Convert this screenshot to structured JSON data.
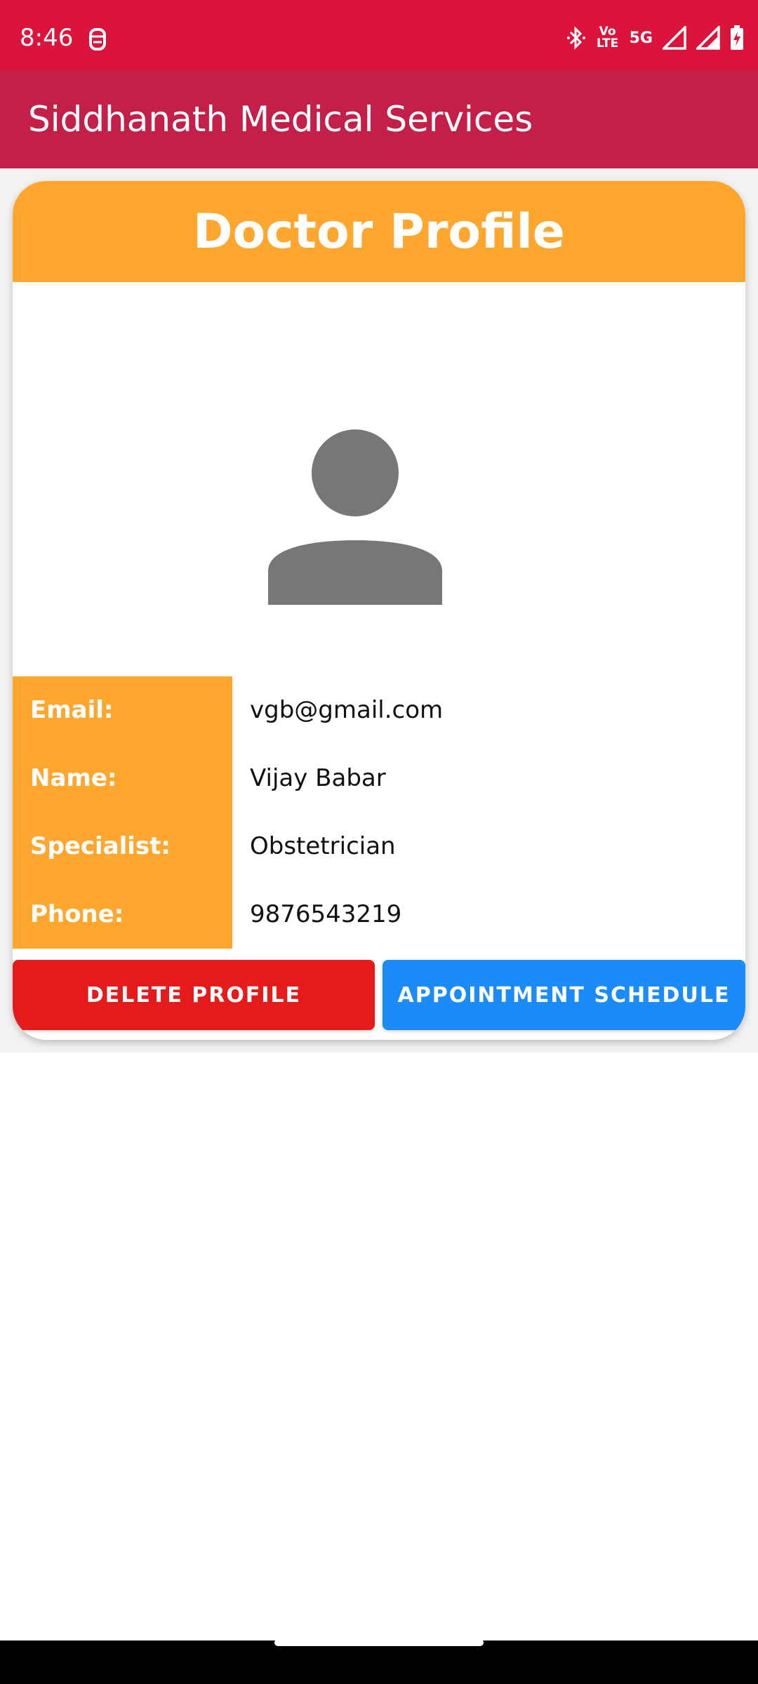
{
  "status_bar": {
    "time": "8:46",
    "volte_label": "Vo LTE",
    "network_label": "5G",
    "icons": [
      "notification-icon",
      "bluetooth-icon",
      "volte-icon",
      "5g-icon",
      "signal-icon",
      "signal-icon-2",
      "battery-charging-icon"
    ]
  },
  "app_bar": {
    "title": "Siddhanath Medical Services"
  },
  "card": {
    "title": "Doctor Profile",
    "avatar_icon": "person-icon"
  },
  "profile": {
    "rows": [
      {
        "label": "Email:",
        "value": "vgb@gmail.com"
      },
      {
        "label": "Name:",
        "value": "Vijay Babar"
      },
      {
        "label": "Specialist:",
        "value": "Obstetrician"
      },
      {
        "label": "Phone:",
        "value": "9876543219"
      }
    ]
  },
  "actions": {
    "delete_label": "DELETE PROFILE",
    "schedule_label": "APPOINTMENT SCHEDULE"
  },
  "colors": {
    "status_bar": "#dc143c",
    "app_bar": "#c41f48",
    "accent_orange": "#ffa62f",
    "delete_red": "#e51b1b",
    "schedule_blue": "#1a8bf7"
  }
}
